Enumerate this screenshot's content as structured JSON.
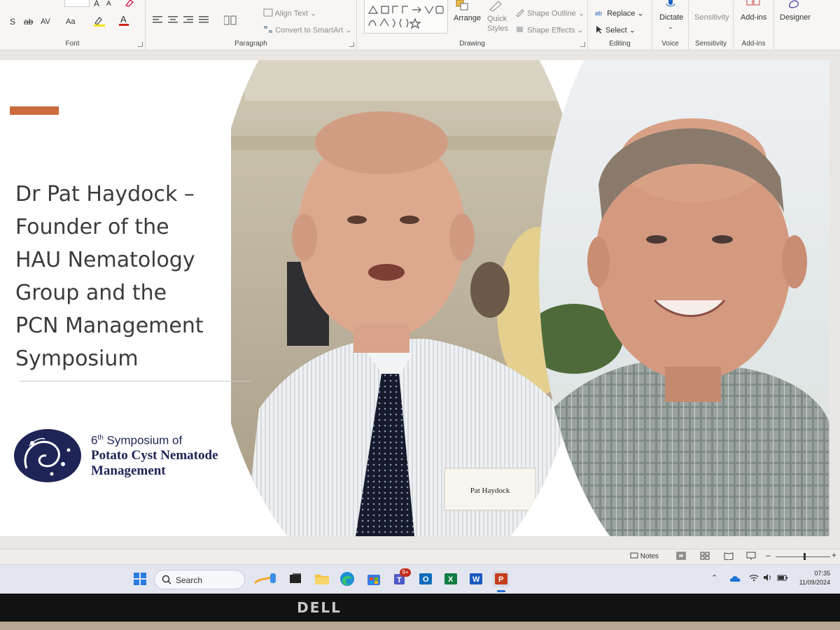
{
  "ribbon": {
    "font_group": {
      "label": "Font",
      "size_buttons": [
        "A",
        "A"
      ],
      "spacing": "AV",
      "case": "Aa"
    },
    "paragraph_group": {
      "label": "Paragraph",
      "align_text": "Align Text",
      "convert_smartart": "Convert to SmartArt"
    },
    "drawing_group": {
      "label": "Drawing",
      "arrange": "Arrange",
      "quick_styles": "Quick Styles",
      "shape_outline": "Shape Outline",
      "shape_effects": "Shape Effects"
    },
    "editing_group": {
      "label": "Editing",
      "replace": "Replace",
      "select": "Select"
    },
    "voice_group": {
      "label": "Voice",
      "dictate": "Dictate"
    },
    "sensitivity_group": {
      "label": "Sensitivity",
      "sensitivity": "Sensitivity"
    },
    "addins_group": {
      "label": "Add-ins",
      "addins": "Add-ins"
    },
    "designer": "Designer"
  },
  "slide": {
    "accent_color": "#cc6b3d",
    "title_lines": [
      "Dr Pat Haydock –",
      "Founder of the",
      "HAU Nematology",
      "Group and the",
      "PCN Management",
      "Symposium"
    ],
    "logo": {
      "line1_prefix": "6",
      "line1_sup": "th",
      "line1_rest": " Symposium of",
      "line2": "Potato Cyst Nematode",
      "line3": "Management",
      "color": "#1e2456"
    },
    "photo1_name_badge": "Pat Haydock"
  },
  "statusbar": {
    "notes": "Notes"
  },
  "taskbar": {
    "search_placeholder": "Search",
    "teams_badge": "9+",
    "time": "07:35",
    "date": "11/09/2024"
  },
  "monitor": {
    "brand": "DELL"
  }
}
